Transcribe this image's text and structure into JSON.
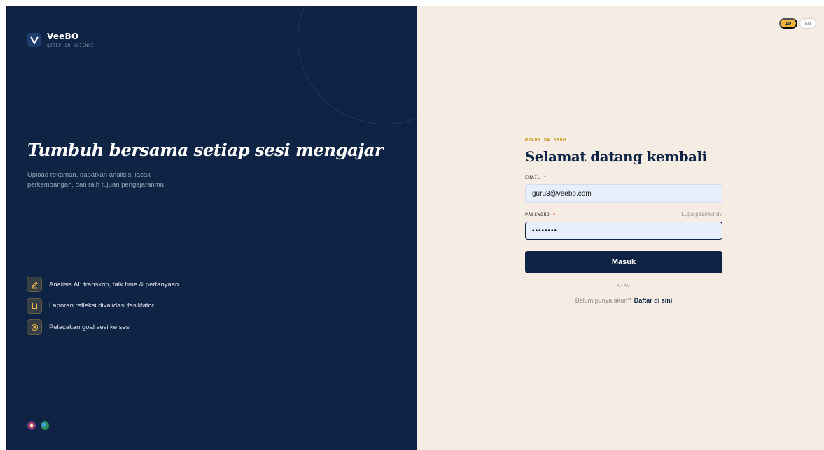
{
  "brand": {
    "logo_letter": "V",
    "name": "VeeBO",
    "subtitle": "QITEP IN SCIENCE"
  },
  "hero": {
    "title": "Tumbuh bersama setiap sesi mengajar",
    "description": "Upload rekaman, dapatkan analisis, lacak perkembangan, dan raih tujuan pengajaranmu."
  },
  "features": [
    {
      "icon": "pencil-icon",
      "label": "Analisis AI: transkrip, talk time & pertanyaan"
    },
    {
      "icon": "document-icon",
      "label": "Laporan refleksi divalidasi fasilitator"
    },
    {
      "icon": "target-icon",
      "label": "Pelacakan goal sesi ke sesi"
    }
  ],
  "language": {
    "options": [
      "ID",
      "EN"
    ],
    "selected": "ID"
  },
  "login": {
    "eyebrow": "MASUK KE AKUN",
    "heading": "Selamat datang kembali",
    "email_label": "EMAIL",
    "email_value": "guru3@veebo.com",
    "password_label": "PASSWORD",
    "required_mark": "*",
    "forgot_label": "Lupa password?",
    "password_value": "••••••••",
    "submit_label": "Masuk",
    "divider_label": "ATAU",
    "register_prompt": "Belum punya akun?",
    "register_link": "Daftar di sini"
  },
  "colors": {
    "navy": "#0f2344",
    "cream": "#f5ede3",
    "accent": "#efb33a",
    "required": "#d3472a"
  }
}
